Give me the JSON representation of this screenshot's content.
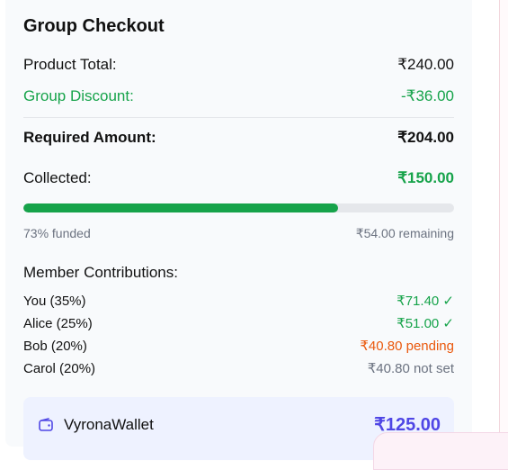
{
  "title": "Group Checkout",
  "summary": {
    "product_label": "Product Total:",
    "product_value": "₹240.00",
    "discount_label": "Group Discount:",
    "discount_value": "-₹36.00",
    "required_label": "Required Amount:",
    "required_value": "₹204.00",
    "collected_label": "Collected:",
    "collected_value": "₹150.00"
  },
  "progress": {
    "fraction": 0.73,
    "funded_text": "73% funded",
    "remaining_text": "₹54.00 remaining"
  },
  "members_heading": "Member Contributions:",
  "members": [
    {
      "name": "You (35%)",
      "status": "₹71.40 ✓",
      "state": "paid"
    },
    {
      "name": "Alice (25%)",
      "status": "₹51.00 ✓",
      "state": "paid"
    },
    {
      "name": "Bob (20%)",
      "status": "₹40.80 pending",
      "state": "pending"
    },
    {
      "name": "Carol (20%)",
      "status": "₹40.80 not set",
      "state": "notset"
    }
  ],
  "wallet": {
    "icon": "wallet-icon",
    "label": "VyronaWallet",
    "amount": "₹125.00"
  },
  "colors": {
    "accent_green": "#16a34a",
    "pending_orange": "#ea580c",
    "wallet_indigo": "#4f46e5"
  }
}
